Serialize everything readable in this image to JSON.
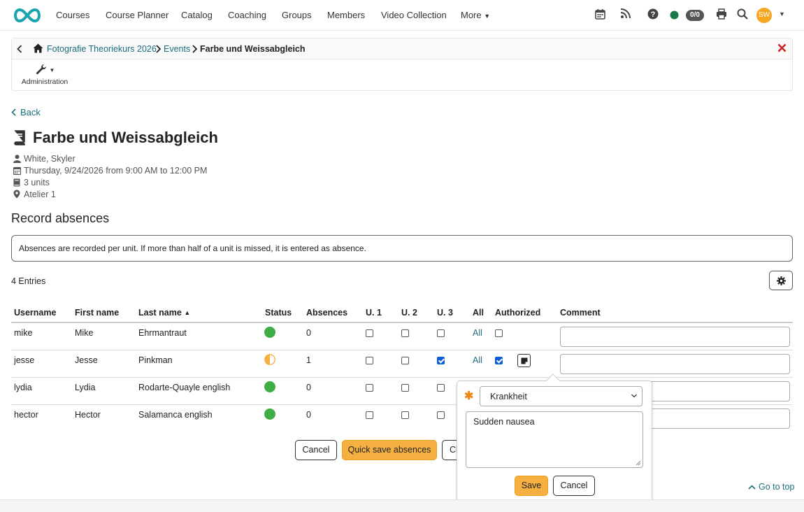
{
  "nav": {
    "items": [
      "Courses",
      "Course Planner",
      "Catalog",
      "Coaching",
      "Groups",
      "Members",
      "Video Collection",
      "More"
    ],
    "counter": "0/0",
    "avatar_initials": "SW",
    "status_color": "#1a7a4a"
  },
  "breadcrumb": {
    "course": "Fotografie Theoriekurs 2026",
    "events": "Events",
    "current": "Farbe und Weissabgleich"
  },
  "toolbar": {
    "admin_label": "Administration"
  },
  "back_label": "Back",
  "event": {
    "title": "Farbe und Weissabgleich",
    "teacher": "White, Skyler",
    "datetime": "Thursday, 9/24/2026 from 9:00 AM to 12:00 PM",
    "units": "3 units",
    "location": "Atelier 1"
  },
  "section": {
    "title": "Record absences",
    "info": "Absences are recorded per unit. If more than half of a unit is missed, it is entered as absence.",
    "entries": "4 Entries"
  },
  "table": {
    "headers": [
      "Username",
      "First name",
      "Last name",
      "Status",
      "Absences",
      "U. 1",
      "U. 2",
      "U. 3",
      "All",
      "Authorized",
      "Comment"
    ],
    "rows": [
      {
        "username": "mike",
        "first": "Mike",
        "last": "Ehrmantraut",
        "status": "present",
        "absences": "0",
        "u1": false,
        "u2": false,
        "u3": false,
        "all": "All",
        "authorized": false
      },
      {
        "username": "jesse",
        "first": "Jesse",
        "last": "Pinkman",
        "status": "partial",
        "absences": "1",
        "u1": false,
        "u2": false,
        "u3": true,
        "all": "All",
        "authorized": true
      },
      {
        "username": "lydia",
        "first": "Lydia",
        "last": "Rodarte-Quayle english",
        "status": "present",
        "absences": "0",
        "u1": false,
        "u2": false,
        "u3": false
      },
      {
        "username": "hector",
        "first": "Hector",
        "last": "Salamanca english",
        "status": "present",
        "absences": "0",
        "u1": false,
        "u2": false,
        "u3": false
      }
    ]
  },
  "buttons": {
    "cancel": "Cancel",
    "quick_save": "Quick save absences",
    "close_partial": "Cl"
  },
  "popover": {
    "reason": "Krankheit",
    "comment": "Sudden nausea",
    "save": "Save",
    "cancel": "Cancel"
  },
  "go_to_top": "Go to top",
  "colors": {
    "link": "#1c6f7e",
    "present": "#3fad46",
    "partial": "#f5b041",
    "primary": "#f5b041",
    "close": "#d11c1c"
  }
}
